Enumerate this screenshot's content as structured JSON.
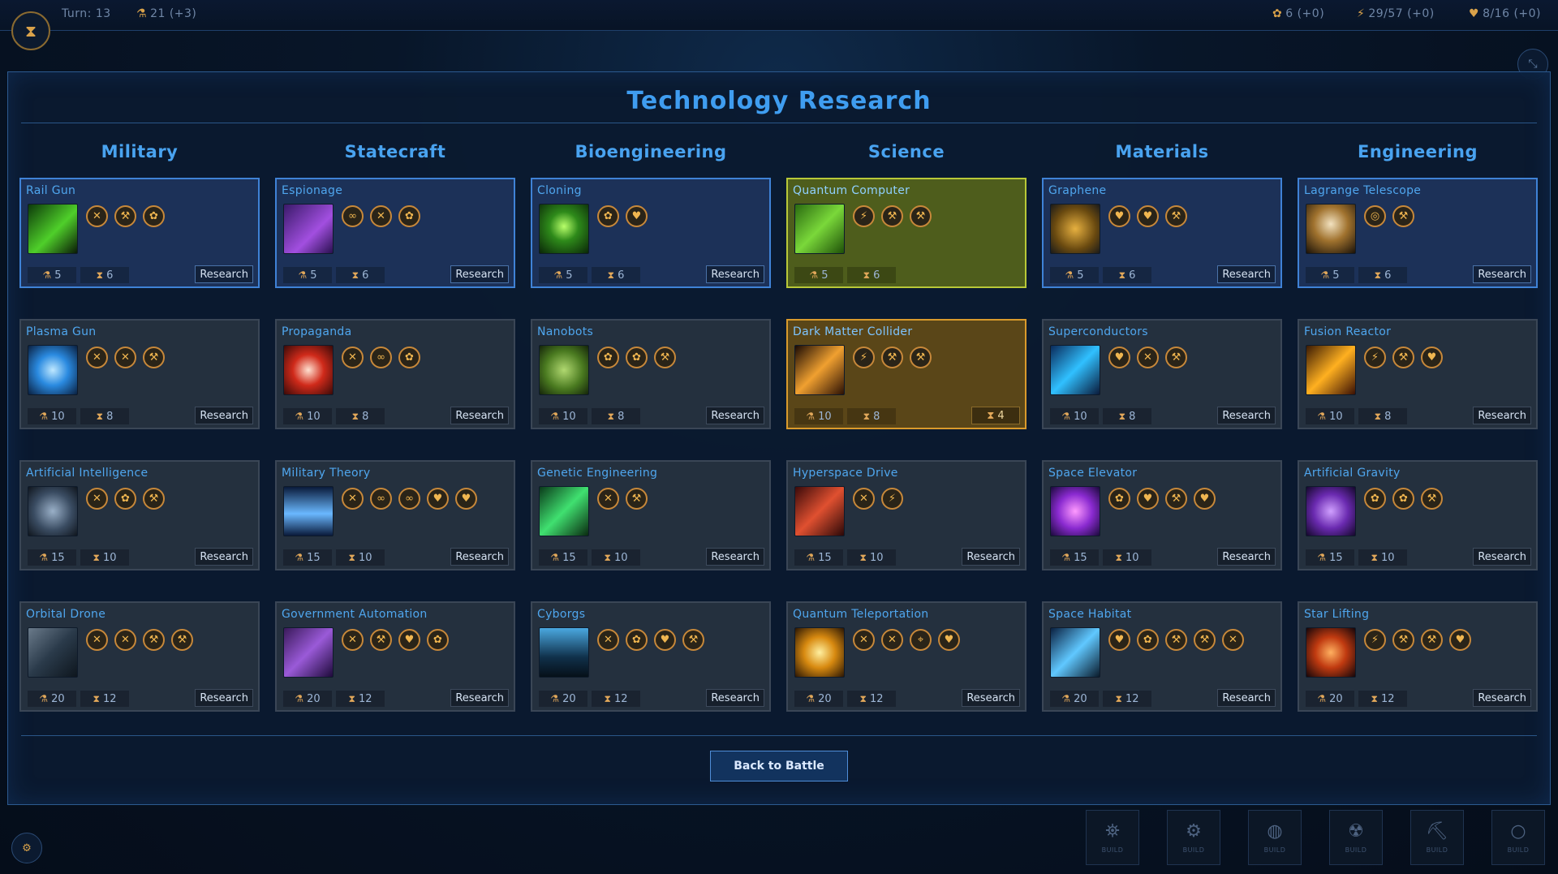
{
  "topbar": {
    "turn": "Turn: 13",
    "science": "21 (+3)",
    "food": "6 (+0)",
    "energy": "29/57 (+0)",
    "hearts": "8/16 (+0)"
  },
  "modal": {
    "title": "Technology Research",
    "back_label": "Back to Battle"
  },
  "columns": [
    "Military",
    "Statecraft",
    "Bioengineering",
    "Science",
    "Materials",
    "Engineering"
  ],
  "research_label": "Research",
  "build_label": "BUILD",
  "colors": {
    "accent": "#3f9df0",
    "completed": "#b8c838",
    "in_progress": "#d99a2c",
    "available": "#3f82d6"
  },
  "techs": [
    {
      "name": "Rail Gun",
      "state": "available",
      "cost": "5",
      "time": "6",
      "action": "Research",
      "effects": [
        "swords-icon",
        "wrench-icon",
        "food-icon"
      ],
      "thumb": "rail-gun"
    },
    {
      "name": "Espionage",
      "state": "available",
      "cost": "5",
      "time": "6",
      "action": "Research",
      "effects": [
        "infinity-icon",
        "swords-icon",
        "food-icon"
      ],
      "thumb": "espionage"
    },
    {
      "name": "Cloning",
      "state": "available",
      "cost": "5",
      "time": "6",
      "action": "Research",
      "effects": [
        "food-icon",
        "heart-icon"
      ],
      "thumb": "cloning"
    },
    {
      "name": "Quantum Computer",
      "state": "done",
      "cost": "5",
      "time": "6",
      "action": "",
      "effects": [
        "bolt-icon",
        "wrench-icon",
        "wrench-icon"
      ],
      "thumb": "quantum-computer"
    },
    {
      "name": "Graphene",
      "state": "available",
      "cost": "5",
      "time": "6",
      "action": "Research",
      "effects": [
        "heart-icon",
        "heart-icon",
        "wrench-icon"
      ],
      "thumb": "graphene"
    },
    {
      "name": "Lagrange Telescope",
      "state": "available",
      "cost": "5",
      "time": "6",
      "action": "Research",
      "effects": [
        "radar-icon",
        "wrench-icon"
      ],
      "thumb": "lagrange-telescope"
    },
    {
      "name": "Plasma Gun",
      "state": "locked",
      "cost": "10",
      "time": "8",
      "action": "Research",
      "effects": [
        "swords-icon",
        "swords-icon",
        "wrench-icon"
      ],
      "thumb": "plasma-gun"
    },
    {
      "name": "Propaganda",
      "state": "locked",
      "cost": "10",
      "time": "8",
      "action": "Research",
      "effects": [
        "swords-icon",
        "infinity-icon",
        "food-icon"
      ],
      "thumb": "propaganda"
    },
    {
      "name": "Nanobots",
      "state": "locked",
      "cost": "10",
      "time": "8",
      "action": "Research",
      "effects": [
        "food-icon",
        "food-icon",
        "wrench-icon"
      ],
      "thumb": "nanobots"
    },
    {
      "name": "Dark Matter Collider",
      "state": "progress",
      "cost": "10",
      "time": "8",
      "action": "4",
      "effects": [
        "bolt-icon",
        "wrench-icon",
        "wrench-icon"
      ],
      "thumb": "dark-matter-collider"
    },
    {
      "name": "Superconductors",
      "state": "locked",
      "cost": "10",
      "time": "8",
      "action": "Research",
      "effects": [
        "heart-icon",
        "swords-icon",
        "wrench-icon"
      ],
      "thumb": "superconductors"
    },
    {
      "name": "Fusion Reactor",
      "state": "locked",
      "cost": "10",
      "time": "8",
      "action": "Research",
      "effects": [
        "bolt-icon",
        "wrench-icon",
        "heart-icon"
      ],
      "thumb": "fusion-reactor"
    },
    {
      "name": "Artificial Intelligence",
      "state": "locked",
      "cost": "15",
      "time": "10",
      "action": "Research",
      "effects": [
        "swords-icon",
        "food-icon",
        "wrench-icon"
      ],
      "thumb": "artificial-intelligence"
    },
    {
      "name": "Military Theory",
      "state": "locked",
      "cost": "15",
      "time": "10",
      "action": "Research",
      "effects": [
        "swords-icon",
        "infinity-icon",
        "infinity-icon",
        "heart-icon",
        "heart-icon"
      ],
      "thumb": "military-theory"
    },
    {
      "name": "Genetic Engineering",
      "state": "locked",
      "cost": "15",
      "time": "10",
      "action": "Research",
      "effects": [
        "swords-icon",
        "wrench-icon"
      ],
      "thumb": "genetic-engineering"
    },
    {
      "name": "Hyperspace Drive",
      "state": "locked",
      "cost": "15",
      "time": "10",
      "action": "Research",
      "effects": [
        "swords-icon",
        "bolt-icon"
      ],
      "thumb": "hyperspace-drive"
    },
    {
      "name": "Space Elevator",
      "state": "locked",
      "cost": "15",
      "time": "10",
      "action": "Research",
      "effects": [
        "food-icon",
        "heart-icon",
        "wrench-icon",
        "heart-icon"
      ],
      "thumb": "space-elevator"
    },
    {
      "name": "Artificial Gravity",
      "state": "locked",
      "cost": "15",
      "time": "10",
      "action": "Research",
      "effects": [
        "food-icon",
        "food-icon",
        "wrench-icon"
      ],
      "thumb": "artificial-gravity"
    },
    {
      "name": "Orbital Drone",
      "state": "locked",
      "cost": "20",
      "time": "12",
      "action": "Research",
      "effects": [
        "swords-icon",
        "swords-icon",
        "wrench-icon",
        "wrench-icon"
      ],
      "thumb": "orbital-drone"
    },
    {
      "name": "Government Automation",
      "state": "locked",
      "cost": "20",
      "time": "12",
      "action": "Research",
      "effects": [
        "swords-icon",
        "wrench-icon",
        "heart-icon",
        "food-icon"
      ],
      "thumb": "government-automation"
    },
    {
      "name": "Cyborgs",
      "state": "locked",
      "cost": "20",
      "time": "12",
      "action": "Research",
      "effects": [
        "swords-icon",
        "food-icon",
        "heart-icon",
        "wrench-icon"
      ],
      "thumb": "cyborgs"
    },
    {
      "name": "Quantum Teleportation",
      "state": "locked",
      "cost": "20",
      "time": "12",
      "action": "Research",
      "effects": [
        "swords-icon",
        "swords-icon",
        "telescope-icon",
        "heart-icon"
      ],
      "thumb": "quantum-teleportation"
    },
    {
      "name": "Space Habitat",
      "state": "locked",
      "cost": "20",
      "time": "12",
      "action": "Research",
      "effects": [
        "heart-icon",
        "food-icon",
        "wrench-icon",
        "wrench-icon",
        "swords-icon"
      ],
      "thumb": "space-habitat"
    },
    {
      "name": "Star Lifting",
      "state": "locked",
      "cost": "20",
      "time": "12",
      "action": "Research",
      "effects": [
        "bolt-icon",
        "wrench-icon",
        "wrench-icon",
        "heart-icon"
      ],
      "thumb": "star-lifting"
    }
  ],
  "build_bar": [
    "satellite-icon",
    "gear-icon",
    "globe-icon",
    "radiation-icon",
    "pickaxe-icon",
    "circle-icon"
  ]
}
